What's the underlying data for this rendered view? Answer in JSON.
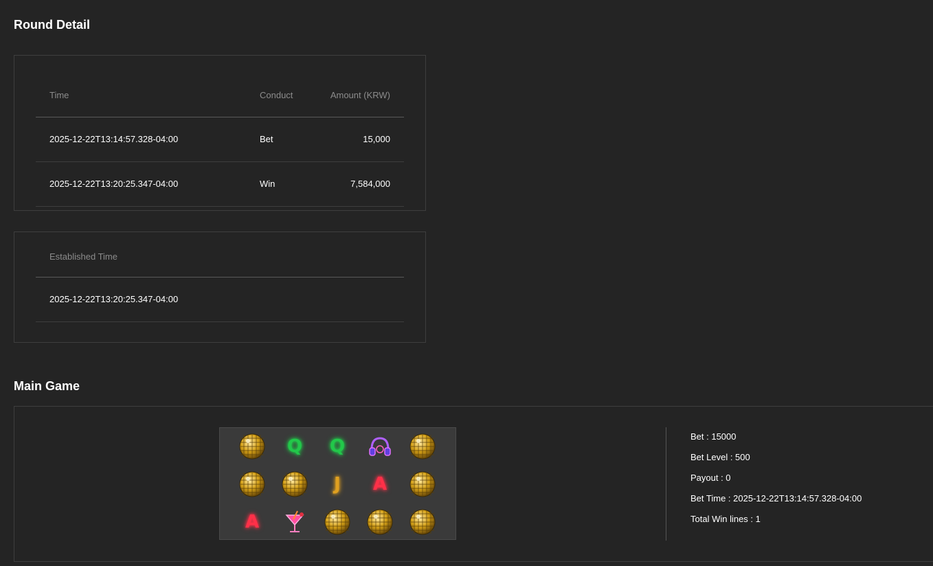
{
  "round_detail": {
    "title": "Round Detail",
    "headers": {
      "time": "Time",
      "conduct": "Conduct",
      "amount": "Amount (KRW)"
    },
    "rows": [
      {
        "time": "2025-12-22T13:14:57.328-04:00",
        "conduct": "Bet",
        "amount": "15,000"
      },
      {
        "time": "2025-12-22T13:20:25.347-04:00",
        "conduct": "Win",
        "amount": "7,584,000"
      }
    ]
  },
  "established": {
    "header": "Established Time",
    "value": "2025-12-22T13:20:25.347-04:00"
  },
  "main_game": {
    "title": "Main Game",
    "reels": [
      [
        "disco-ball",
        "Q",
        "Q",
        "headphones",
        "disco-ball"
      ],
      [
        "disco-ball",
        "disco-ball",
        "J",
        "A",
        "disco-ball"
      ],
      [
        "A",
        "cocktail",
        "disco-ball",
        "disco-ball",
        "disco-ball"
      ]
    ],
    "symbol_colors": {
      "Q": "#22c84a",
      "J": "#e0a020",
      "A": "#ff3048",
      "disco-ball": "#d4a017"
    },
    "info": {
      "bet": "Bet : 15000",
      "bet_level": "Bet Level : 500",
      "payout": "Payout : 0",
      "bet_time": "Bet Time : 2025-12-22T13:14:57.328-04:00",
      "total_win_lines": "Total Win lines : 1"
    }
  }
}
